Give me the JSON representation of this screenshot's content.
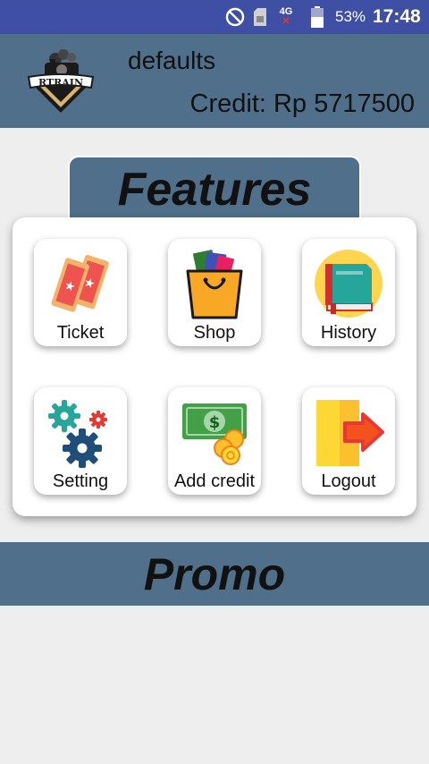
{
  "status_bar": {
    "network": "4G",
    "battery": "53%",
    "time": "17:48",
    "icons": [
      "do-not-disturb-icon",
      "sim-card-icon",
      "no-signal-icon",
      "battery-icon"
    ]
  },
  "header": {
    "logo_text": "RTRAIN",
    "username": "defaults",
    "credit_label": "Credit:",
    "credit_value": "Rp 5717500"
  },
  "features": {
    "title": "Features",
    "items": [
      {
        "label": "Ticket",
        "icon": "ticket-icon"
      },
      {
        "label": "Shop",
        "icon": "shopping-bag-icon"
      },
      {
        "label": "History",
        "icon": "book-icon"
      },
      {
        "label": "Setting",
        "icon": "gears-icon"
      },
      {
        "label": "Add credit",
        "icon": "money-icon"
      },
      {
        "label": "Logout",
        "icon": "logout-icon"
      }
    ]
  },
  "promo": {
    "title": "Promo"
  }
}
